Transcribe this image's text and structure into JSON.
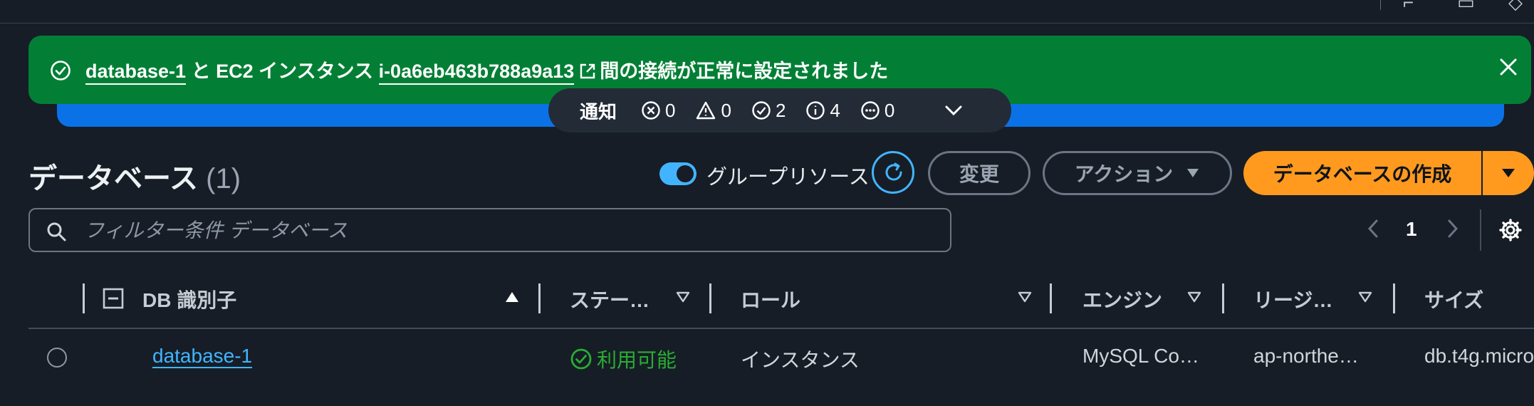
{
  "flash": {
    "db_link": "database-1",
    "text_mid": "と EC2 インスタンス",
    "instance_link": "i-0a6eb463b788a9a13",
    "text_end": "間の接続が正常に設定されました"
  },
  "notifications": {
    "label": "通知",
    "errors": "0",
    "warnings": "0",
    "success": "2",
    "info": "4",
    "in_progress": "0"
  },
  "header": {
    "title": "データベース",
    "count": "(1)",
    "group_toggle_label": "グループリソース",
    "modify_label": "変更",
    "actions_label": "アクション",
    "create_label": "データベースの作成"
  },
  "filter": {
    "placeholder": "フィルター条件 データベース"
  },
  "pagination": {
    "current_page": "1"
  },
  "table": {
    "columns": {
      "db_id": "DB 識別子",
      "status": "ステー…",
      "role": "ロール",
      "engine": "エンジン",
      "region": "リージ…",
      "size": "サイズ"
    },
    "rows": [
      {
        "db_id": "database-1",
        "status": "利用可能",
        "role": "インスタンス",
        "engine": "MySQL Co…",
        "region": "ap-northe…",
        "size": "db.t4g.micro"
      }
    ]
  },
  "colors": {
    "background": "#161d26",
    "flash_success": "#037f35",
    "primary_button": "#ff9a1f",
    "link": "#42b4ff",
    "status_available": "#29ad32"
  }
}
